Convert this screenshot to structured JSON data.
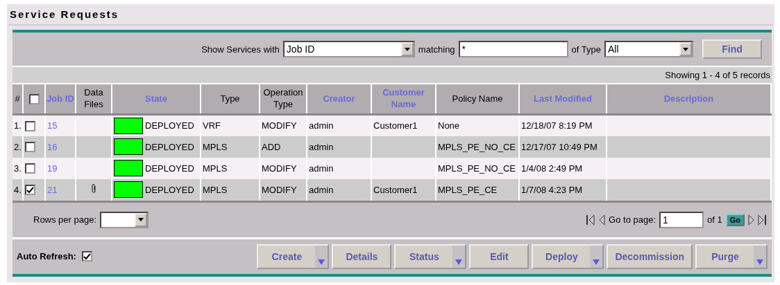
{
  "title": "Service Requests",
  "filter": {
    "label": "Show Services with",
    "field": "Job ID",
    "matching_label": "matching",
    "matching_value": "*",
    "type_label": "of Type",
    "type_value": "All",
    "find_button": "Find"
  },
  "records_summary": "Showing 1 - 4 of 5 records",
  "select_all": {
    "checked": false
  },
  "table": {
    "columns": [
      {
        "label": "#",
        "sortable": false
      },
      {
        "label": "Job ID",
        "sortable": true
      },
      {
        "label": "Data Files",
        "sortable": false
      },
      {
        "label": "State",
        "sortable": true
      },
      {
        "label": "Type",
        "sortable": false
      },
      {
        "label": "Operation Type",
        "sortable": false
      },
      {
        "label": "Creator",
        "sortable": true
      },
      {
        "label": "Customer Name",
        "sortable": true
      },
      {
        "label": "Policy Name",
        "sortable": false
      },
      {
        "label": "Last Modified",
        "sortable": true
      },
      {
        "label": "Description",
        "sortable": true
      }
    ],
    "rows": [
      {
        "number": "1.",
        "checked": false,
        "job_id": "15",
        "attachment": false,
        "color": "#00ff00",
        "state": "DEPLOYED",
        "type": "VRF",
        "operation": "MODIFY",
        "creator": "admin",
        "customer": "Customer1",
        "policy": "None",
        "modified": "12/18/07 8:19 PM"
      },
      {
        "number": "2.",
        "checked": false,
        "job_id": "16",
        "attachment": false,
        "color": "#00ff00",
        "state": "DEPLOYED",
        "type": "MPLS",
        "operation": "ADD",
        "creator": "admin",
        "policy": "MPLS_PE_NO_CE",
        "modified": "12/17/07 10:49 PM"
      },
      {
        "number": "3.",
        "checked": false,
        "job_id": "19",
        "attachment": false,
        "color": "#00ff00",
        "state": "DEPLOYED",
        "type": "MPLS",
        "operation": "MODIFY",
        "creator": "admin",
        "policy": "MPLS_PE_NO_CE",
        "modified": "1/4/08 2:49 PM"
      },
      {
        "number": "4.",
        "checked": true,
        "job_id": "21",
        "attachment": true,
        "color": "#00ff00",
        "state": "DEPLOYED",
        "type": "MPLS",
        "operation": "MODIFY",
        "creator": "admin",
        "customer": "Customer1",
        "policy": "MPLS_PE_CE",
        "modified": "1/7/08 4:23 PM"
      }
    ]
  },
  "pagination": {
    "rows_per_page_label": "Rows per page:",
    "goto_label": "Go to page:",
    "page": "1",
    "of_label": "of 1",
    "go_button": "Go"
  },
  "auto_refresh": {
    "label": "Auto Refresh:",
    "checked": true
  },
  "actions": [
    {
      "label": "Create",
      "has_menu": true
    },
    {
      "label": "Details",
      "has_menu": false
    },
    {
      "label": "Status",
      "has_menu": true
    },
    {
      "label": "Edit",
      "has_menu": false
    },
    {
      "label": "Deploy",
      "has_menu": true
    },
    {
      "label": "Decommission",
      "has_menu": false
    },
    {
      "label": "Purge",
      "has_menu": true
    }
  ]
}
